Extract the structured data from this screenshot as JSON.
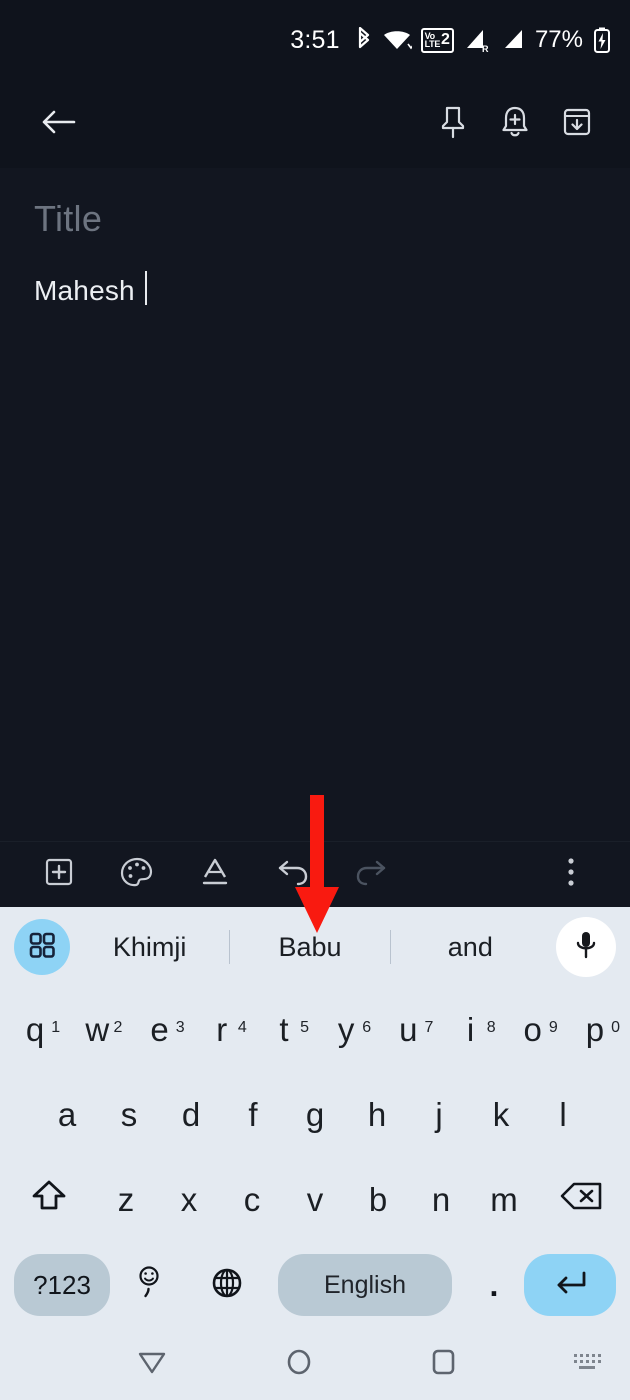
{
  "status_bar": {
    "time": "3:51",
    "battery_percent": "77%",
    "icons": [
      "bluetooth-icon",
      "wifi-icon",
      "volte-icon",
      "signal-roaming-icon",
      "signal-icon",
      "battery-charging-icon"
    ],
    "volte_label": "Vo",
    "volte_label2": "LTE",
    "volte_sim": "2",
    "roaming_label": "R"
  },
  "app_bar": {
    "back_icon": "back-arrow-icon",
    "actions": [
      {
        "name": "pin-button",
        "icon": "pin-icon"
      },
      {
        "name": "reminder-button",
        "icon": "add-alert-icon"
      },
      {
        "name": "archive-button",
        "icon": "archive-icon"
      }
    ]
  },
  "note": {
    "title_placeholder": "Title",
    "body_text": "Mahesh"
  },
  "edit_bar": {
    "buttons": [
      {
        "name": "add-content-button",
        "icon": "add-box-icon",
        "enabled": true
      },
      {
        "name": "background-options-button",
        "icon": "palette-icon",
        "enabled": true
      },
      {
        "name": "text-format-button",
        "icon": "format-text-icon",
        "enabled": true
      },
      {
        "name": "undo-button",
        "icon": "undo-icon",
        "enabled": true
      },
      {
        "name": "redo-button",
        "icon": "redo-icon",
        "enabled": false
      },
      {
        "name": "more-options-button",
        "icon": "overflow-menu-icon",
        "enabled": true
      }
    ]
  },
  "keyboard": {
    "grid_icon": "app-grid-icon",
    "mic_icon": "microphone-icon",
    "suggestions": [
      "Khimji",
      "Babu",
      "and"
    ],
    "rows": [
      [
        {
          "key": "q",
          "num": "1"
        },
        {
          "key": "w",
          "num": "2"
        },
        {
          "key": "e",
          "num": "3"
        },
        {
          "key": "r",
          "num": "4"
        },
        {
          "key": "t",
          "num": "5"
        },
        {
          "key": "y",
          "num": "6"
        },
        {
          "key": "u",
          "num": "7"
        },
        {
          "key": "i",
          "num": "8"
        },
        {
          "key": "o",
          "num": "9"
        },
        {
          "key": "p",
          "num": "0"
        }
      ],
      [
        {
          "key": "a"
        },
        {
          "key": "s"
        },
        {
          "key": "d"
        },
        {
          "key": "f"
        },
        {
          "key": "g"
        },
        {
          "key": "h"
        },
        {
          "key": "j"
        },
        {
          "key": "k"
        },
        {
          "key": "l"
        }
      ],
      [
        {
          "key": "z"
        },
        {
          "key": "x"
        },
        {
          "key": "c"
        },
        {
          "key": "v"
        },
        {
          "key": "b"
        },
        {
          "key": "n"
        },
        {
          "key": "m"
        }
      ]
    ],
    "shift_icon": "shift-icon",
    "backspace_icon": "backspace-icon",
    "symbols_label": "?123",
    "emoji_icon": "emoji-comma-icon",
    "globe_icon": "language-globe-icon",
    "space_label": "English",
    "period_label": ".",
    "enter_icon": "enter-key-icon"
  },
  "nav_bar": {
    "back_icon": "hide-keyboard-icon",
    "home_icon": "home-circle-icon",
    "recents_icon": "recents-square-icon",
    "keyboard_switch_icon": "keyboard-switcher-icon"
  },
  "annotation": {
    "arrow_color": "#f91a10",
    "arrow_icon": "red-down-arrow-annotation",
    "points_at": "Babu"
  }
}
